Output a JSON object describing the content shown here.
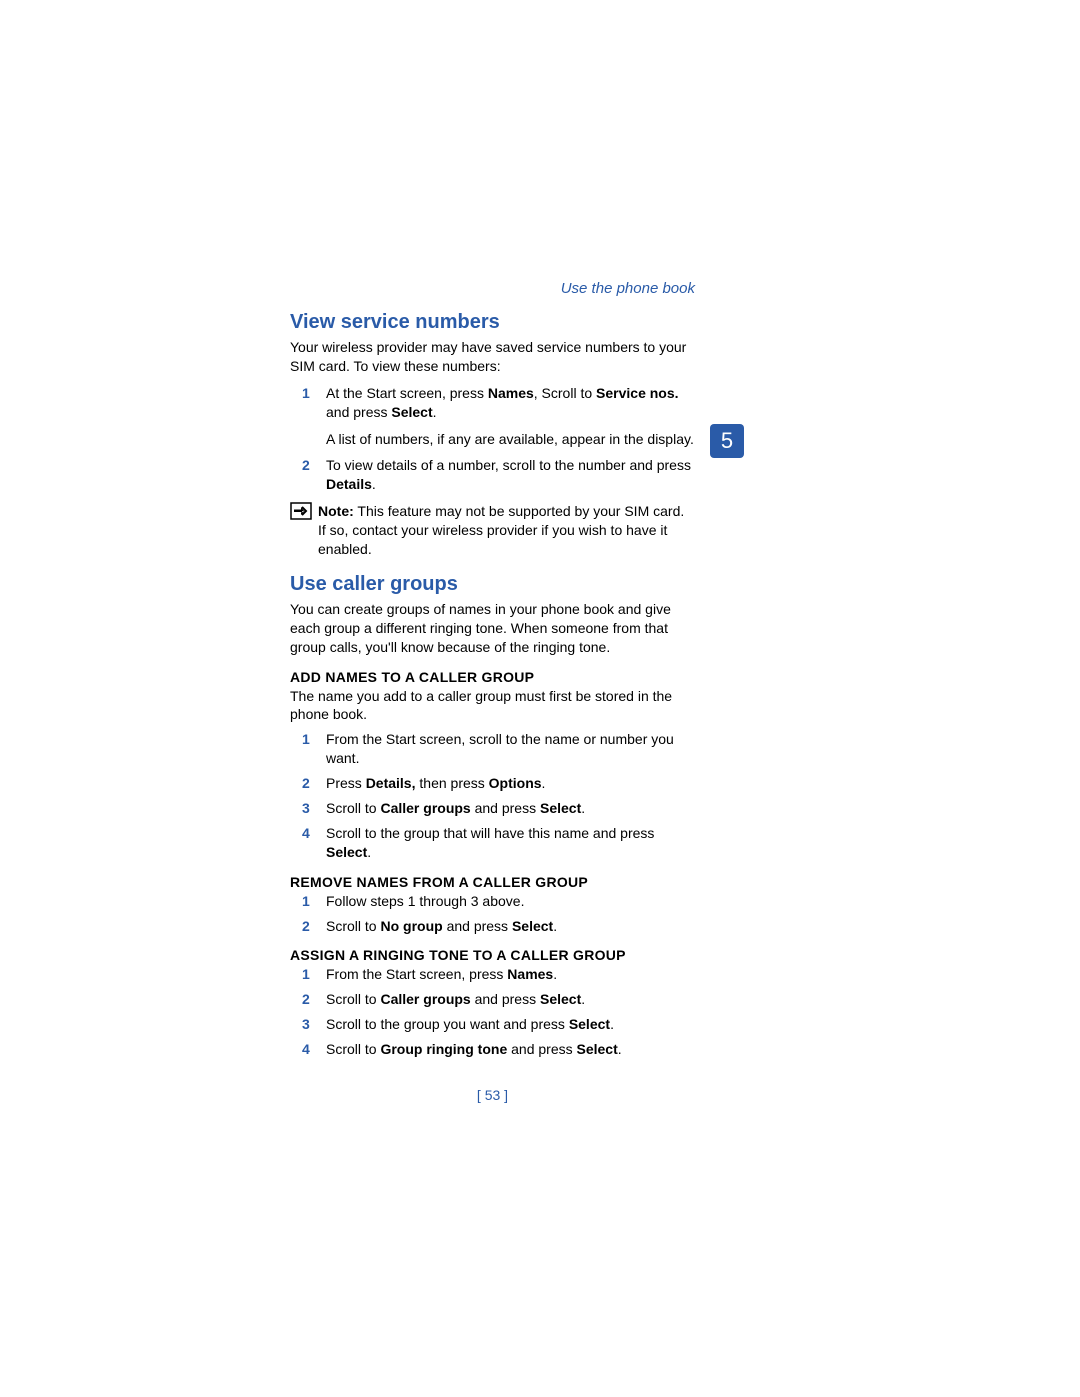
{
  "header": {
    "chapter": "Use the phone book"
  },
  "chapter_badge": "5",
  "section1": {
    "title": "View service numbers",
    "intro": "Your wireless provider may have saved service numbers to your SIM card. To view these numbers:",
    "steps": [
      {
        "num": "1",
        "html": "At the Start screen, press <b>Names</b>, Scroll to <b>Service nos.</b> and press <b>Select</b>."
      },
      {
        "num": "2",
        "html": "To view details of a number, scroll to the number and press <b>Details</b>."
      }
    ],
    "after_step1": "A list of numbers, if any are available, appear in the display.",
    "note_html": "<b>Note:</b> This feature may not be supported by your SIM card. If so, contact your wireless provider if you wish to have it enabled."
  },
  "section2": {
    "title": "Use caller groups",
    "intro": "You can create groups of names in your phone book and give each group a different ringing tone. When someone from that group calls, you'll know because of the ringing tone.",
    "sub_add": {
      "title": "ADD NAMES TO A CALLER GROUP",
      "intro": "The name you add to a caller group must first be stored in the phone book.",
      "steps": [
        {
          "num": "1",
          "html": "From the Start screen, scroll to the name or number you want."
        },
        {
          "num": "2",
          "html": "Press <b>Details,</b> then press <b>Options</b>."
        },
        {
          "num": "3",
          "html": "Scroll to <b>Caller groups</b> and press <b>Select</b>."
        },
        {
          "num": "4",
          "html": "Scroll to the group that will have this name and press <b>Select</b>."
        }
      ]
    },
    "sub_remove": {
      "title": "REMOVE NAMES FROM A CALLER GROUP",
      "steps": [
        {
          "num": "1",
          "html": "Follow steps 1 through 3 above."
        },
        {
          "num": "2",
          "html": "Scroll to <b>No group</b> and press <b>Select</b>."
        }
      ]
    },
    "sub_ring": {
      "title": "ASSIGN A RINGING TONE TO A CALLER GROUP",
      "steps": [
        {
          "num": "1",
          "html": "From the Start screen, press <b>Names</b>."
        },
        {
          "num": "2",
          "html": "Scroll to <b>Caller groups</b> and press <b>Select</b>."
        },
        {
          "num": "3",
          "html": "Scroll to the group you want and press <b>Select</b>."
        },
        {
          "num": "4",
          "html": "Scroll to <b>Group ringing tone</b> and press <b>Select</b>."
        }
      ]
    }
  },
  "footer": {
    "page_number": "[ 53 ]"
  }
}
